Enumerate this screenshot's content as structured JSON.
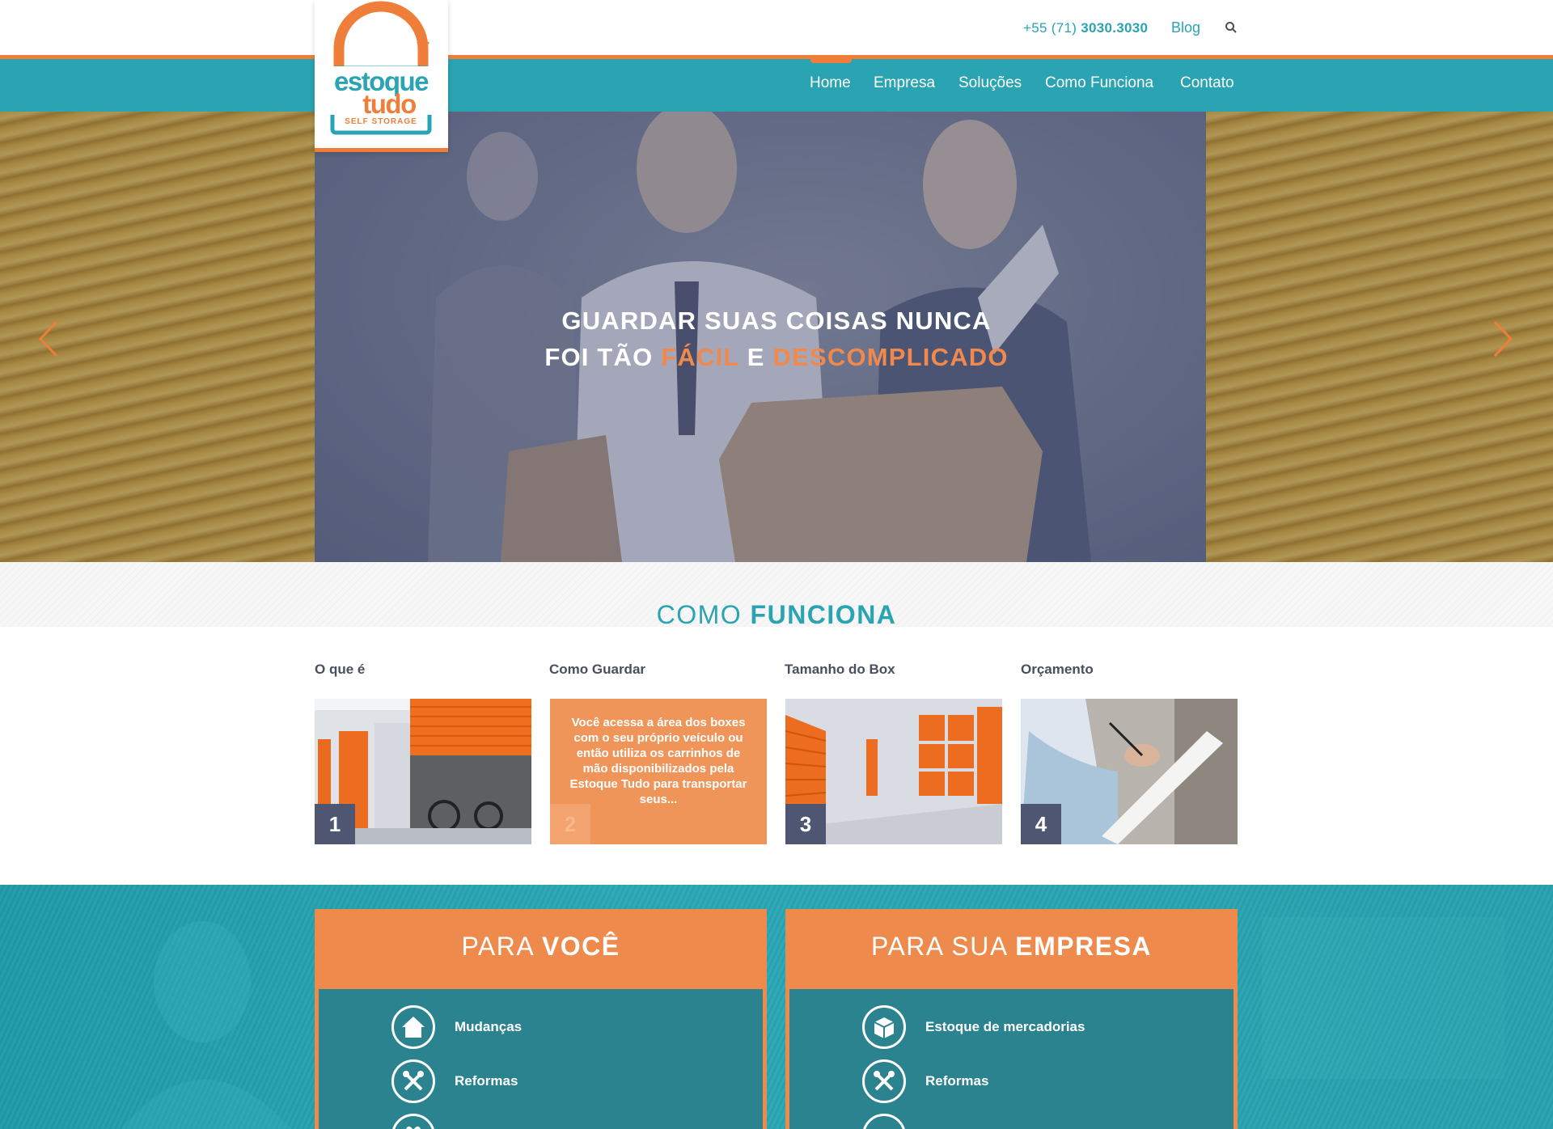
{
  "header": {
    "phone_prefix": "+55 (71)",
    "phone_number": "3030.3030",
    "blog": "Blog",
    "search_icon": "search-icon"
  },
  "logo": {
    "line1": "estoque",
    "line2": "tudo",
    "tagline": "SELF STORAGE"
  },
  "nav": {
    "items": [
      "Home",
      "Empresa",
      "Soluções",
      "Como Funciona",
      "Contato"
    ],
    "active": "Home"
  },
  "hero": {
    "line1": "GUARDAR SUAS COISAS NUNCA",
    "line2_prefix": "FOI TÃO",
    "line2_accent1": "FÁCIL",
    "line2_mid": "E",
    "line2_accent2": "DESCOMPLICADO",
    "prev_icon": "chevron-left-icon",
    "next_icon": "chevron-right-icon"
  },
  "como_funciona": {
    "title_light": "COMO",
    "title_bold": "FUNCIONA",
    "columns": [
      {
        "label": "O que é",
        "number": "1"
      },
      {
        "label": "Como Guardar",
        "number": "2",
        "text": "Você acessa a área dos boxes com o seu próprio veículo ou então utiliza os carrinhos de mão disponibilizados pela Estoque Tudo para transportar seus..."
      },
      {
        "label": "Tamanho do Box",
        "number": "3"
      },
      {
        "label": "Orçamento",
        "number": "4"
      }
    ]
  },
  "para_voce": {
    "title_light": "PARA",
    "title_bold": "VOCÊ",
    "items": [
      "Mudanças",
      "Reformas"
    ]
  },
  "para_empresa": {
    "title_light": "PARA SUA",
    "title_bold": "EMPRESA",
    "items": [
      "Estoque de mercadorias",
      "Reformas"
    ]
  },
  "colors": {
    "teal": "#2aa3b2",
    "orange": "#ef7e3a",
    "dark_slate": "#4f5672"
  }
}
